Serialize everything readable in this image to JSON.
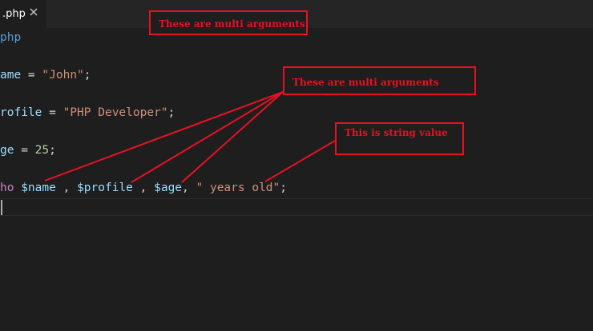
{
  "tab": {
    "label": ".php",
    "close_icon": "close-icon"
  },
  "code_lines": [
    [
      {
        "cls": "kw",
        "text": "php"
      }
    ],
    [],
    [
      {
        "cls": "var",
        "text": "ame"
      },
      {
        "cls": "plain",
        "text": " = "
      },
      {
        "cls": "str",
        "text": "\"John\""
      },
      {
        "cls": "plain",
        "text": ";"
      }
    ],
    [],
    [
      {
        "cls": "var",
        "text": "rofile"
      },
      {
        "cls": "plain",
        "text": " = "
      },
      {
        "cls": "str",
        "text": "\"PHP Developer\""
      },
      {
        "cls": "plain",
        "text": ";"
      }
    ],
    [],
    [
      {
        "cls": "var",
        "text": "ge"
      },
      {
        "cls": "plain",
        "text": " = "
      },
      {
        "cls": "num",
        "text": "25"
      },
      {
        "cls": "plain",
        "text": ";"
      }
    ],
    [],
    [
      {
        "cls": "echo",
        "text": "ho"
      },
      {
        "cls": "plain",
        "text": " "
      },
      {
        "cls": "var",
        "text": "$name"
      },
      {
        "cls": "plain",
        "text": " , "
      },
      {
        "cls": "var",
        "text": "$profile"
      },
      {
        "cls": "plain",
        "text": " , "
      },
      {
        "cls": "var",
        "text": "$age"
      },
      {
        "cls": "plain",
        "text": ", "
      },
      {
        "cls": "str",
        "text": "\" years old\""
      },
      {
        "cls": "plain",
        "text": ";"
      }
    ],
    []
  ],
  "annotations": {
    "top": "These are multi arguments",
    "middle": "These are multi arguments",
    "string": "This is string value"
  },
  "colors": {
    "background": "#1e1e1e",
    "annotation_red": "#e81123",
    "variable": "#9cdcfe",
    "string": "#ce9178",
    "number": "#b5cea8",
    "keyword": "#569cd6"
  }
}
